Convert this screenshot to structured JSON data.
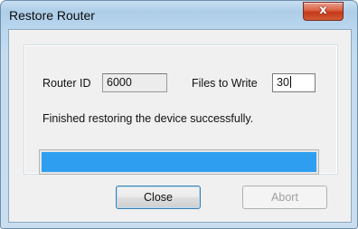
{
  "window": {
    "title": "Restore Router",
    "close_glyph": "x"
  },
  "form": {
    "router_id_label": "Router ID",
    "router_id_value": "6000",
    "files_to_write_label": "Files to Write",
    "files_to_write_value": "30",
    "status_text": "Finished restoring the device successfully."
  },
  "progress": {
    "percent": 100,
    "color": "#2e9ff0"
  },
  "buttons": {
    "close_label": "Close",
    "abort_label": "Abort"
  }
}
